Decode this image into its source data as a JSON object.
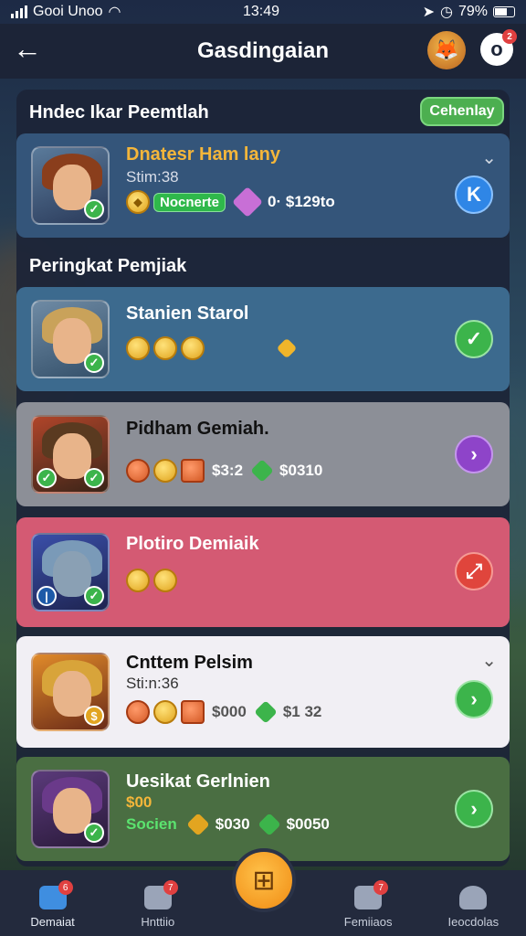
{
  "status_bar": {
    "carrier": "Gooi Unoo",
    "time": "13:49",
    "battery": "79%"
  },
  "header": {
    "title": "Gasdingaian",
    "notification_count": "2"
  },
  "featured": {
    "section_title": "Hndec Ikar Peemtlah",
    "challenge_label": "Cehenlay",
    "card": {
      "name": "Dnatesr Ham lany",
      "stat": "Stim:38",
      "tag": "Nocnerte",
      "value_text": "0· $129to"
    }
  },
  "ranking": {
    "section_title": "Peringkat Pemjiak",
    "cards": [
      {
        "name": "Stanien Starol"
      },
      {
        "name": "Pidham Gemiah.",
        "value1": "$3:2",
        "value2": "$0310"
      },
      {
        "name": "Plotiro Demiaik"
      },
      {
        "name": "Cnttem Pelsim",
        "stat": "Sti:n:36",
        "value1": "$000",
        "value2": "$1 32"
      },
      {
        "name": "Uesikat Gerlnien",
        "stat": "$00",
        "tag": "Socien",
        "value1": "$030",
        "value2": "$0050"
      }
    ]
  },
  "bottom_nav": {
    "items": [
      {
        "label": "Demaiat",
        "badge": "6"
      },
      {
        "label": "Hnttiio",
        "badge": "7"
      },
      {
        "label": "Femiiaos",
        "badge": "7"
      },
      {
        "label": "Ieocdolas"
      }
    ]
  },
  "colors": {
    "panel": "#1c2437",
    "card_blue": "#3c6a8e",
    "card_gray": "#8c8f97",
    "card_pink": "#d45a73",
    "card_white": "#f1eff4",
    "card_green": "#4a6e42",
    "accent_green": "#4caf50",
    "accent_orange": "#f5a623"
  },
  "icons": {
    "back": "arrow-left-icon",
    "mascot": "fox-mascot-icon",
    "notification": "notification-icon",
    "center": "home-plus-icon"
  }
}
